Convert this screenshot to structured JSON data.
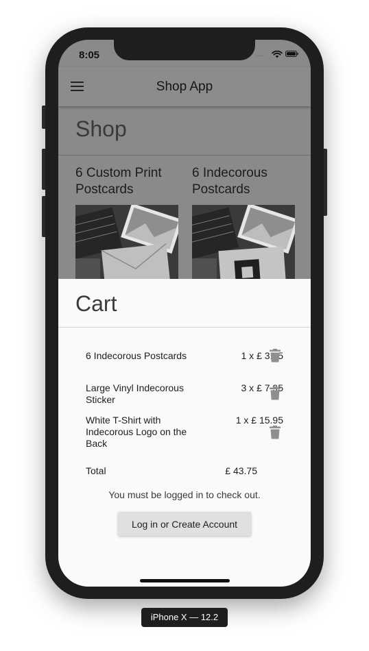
{
  "status_bar": {
    "time": "8:05",
    "signal": "....",
    "icons": [
      "wifi-icon",
      "battery-icon"
    ]
  },
  "app_bar": {
    "title": "Shop App",
    "menu_icon": "hamburger-menu-icon"
  },
  "shop": {
    "heading": "Shop",
    "products": [
      {
        "title": "6 Custom Print Postcards"
      },
      {
        "title": "6 Indecorous Postcards"
      }
    ]
  },
  "cart": {
    "heading": "Cart",
    "items": [
      {
        "name": "6 Indecorous Postcards",
        "price": "1 x £ 3.95"
      },
      {
        "name": "Large Vinyl Indecorous Sticker",
        "price": "3 x £ 7.95"
      },
      {
        "name": "White T-Shirt with Indecorous Logo on the Back",
        "price": "1 x £ 15.95"
      }
    ],
    "total_label": "Total",
    "total_value": "£ 43.75",
    "checkout_note": "You must be logged in to check out.",
    "login_button": "Log in or Create Account"
  },
  "device_label": "iPhone X — 12.2",
  "colors": {
    "scrim": "#8a8a8a",
    "sheet": "#fafafa",
    "button": "#e0e0e0",
    "device": "#1e1e1e"
  }
}
